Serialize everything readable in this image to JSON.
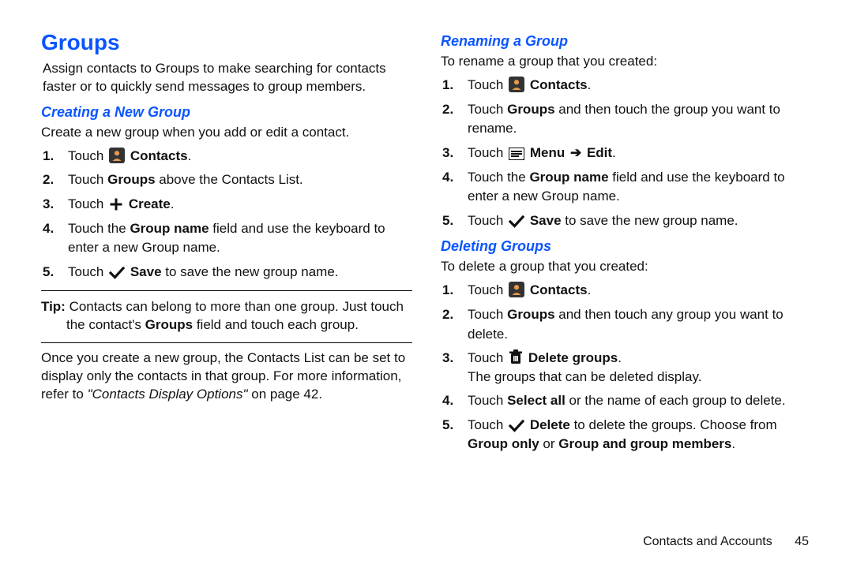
{
  "left": {
    "h1": "Groups",
    "intro": "Assign contacts to Groups to make searching for contacts faster or to quickly send messages to group members.",
    "sub1": "Creating a New Group",
    "sub1_lead": "Create a new group when you add or edit a contact.",
    "s1": {
      "pre": "Touch ",
      "label": "Contacts",
      "post": "."
    },
    "s2": {
      "pre": "Touch ",
      "b1": "Groups",
      "post": " above the Contacts List."
    },
    "s3": {
      "pre": "Touch ",
      "label": "Create",
      "post": "."
    },
    "s4": {
      "pre": "Touch the ",
      "b1": "Group name",
      "post": " field and use the keyboard to enter a new Group name."
    },
    "s5": {
      "pre": "Touch ",
      "b1": "Save",
      "post": " to save the new group name."
    },
    "tip_label": "Tip: ",
    "tip_a": "Contacts can belong to more than one group. Just touch the contact's ",
    "tip_b": "Groups",
    "tip_c": " field and touch each group.",
    "para2a": "Once you create a new group, the Contacts List can be set to display only the contacts in that group. For more information, refer to ",
    "para2_ref": "\"Contacts Display Options\"",
    "para2b": " on page 42."
  },
  "right": {
    "sub1": "Renaming a Group",
    "sub1_lead": "To rename a group that you created:",
    "r1": {
      "pre": "Touch ",
      "label": "Contacts",
      "post": "."
    },
    "r2": {
      "pre": "Touch ",
      "b1": "Groups",
      "post": " and then touch the group you want to rename."
    },
    "r3": {
      "pre": "Touch ",
      "m1": "Menu",
      "arrow": "➔",
      "m2": "Edit",
      "post": "."
    },
    "r4": {
      "pre": "Touch the ",
      "b1": "Group name",
      "post": " field and use the keyboard to enter a new Group name."
    },
    "r5": {
      "pre": "Touch ",
      "b1": "Save",
      "post": " to save the new group name."
    },
    "sub2": "Deleting Groups",
    "sub2_lead": "To delete a group that you created:",
    "d1": {
      "pre": "Touch ",
      "label": "Contacts",
      "post": "."
    },
    "d2": {
      "pre": "Touch ",
      "b1": "Groups",
      "post": " and then touch any group you want to delete."
    },
    "d3": {
      "pre": "Touch ",
      "label": "Delete groups",
      "post": "."
    },
    "d3_note": "The groups that can be deleted display.",
    "d4": {
      "pre": "Touch ",
      "b1": "Select all",
      "post": " or the name of each group to delete."
    },
    "d5": {
      "pre": "Touch ",
      "b1": "Delete",
      "mid": " to delete the groups. Choose from ",
      "b2": "Group only",
      "or": " or ",
      "b3": "Group and group members",
      "post": "."
    }
  },
  "footer": {
    "chapter": "Contacts and Accounts",
    "page": "45"
  }
}
